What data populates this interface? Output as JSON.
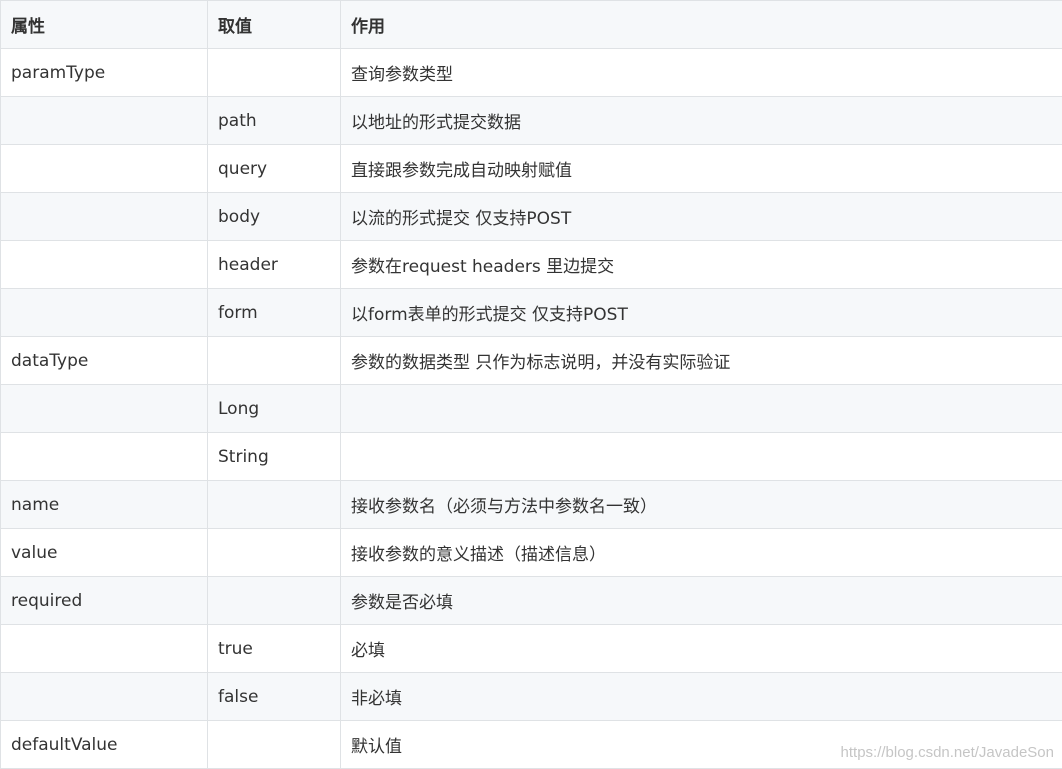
{
  "table": {
    "headers": [
      "属性",
      "取值",
      "作用"
    ],
    "rows": [
      [
        "paramType",
        "",
        "查询参数类型"
      ],
      [
        "",
        "path",
        "以地址的形式提交数据"
      ],
      [
        "",
        "query",
        "直接跟参数完成自动映射赋值"
      ],
      [
        "",
        "body",
        "以流的形式提交 仅支持POST"
      ],
      [
        "",
        "header",
        "参数在request headers 里边提交"
      ],
      [
        "",
        "form",
        "以form表单的形式提交 仅支持POST"
      ],
      [
        "dataType",
        "",
        "参数的数据类型 只作为标志说明，并没有实际验证"
      ],
      [
        "",
        "Long",
        ""
      ],
      [
        "",
        "String",
        ""
      ],
      [
        "name",
        "",
        "接收参数名（必须与方法中参数名一致）"
      ],
      [
        "value",
        "",
        "接收参数的意义描述（描述信息）"
      ],
      [
        "required",
        "",
        "参数是否必填"
      ],
      [
        "",
        "true",
        "必填"
      ],
      [
        "",
        "false",
        "非必填"
      ],
      [
        "defaultValue",
        "",
        "默认值"
      ]
    ]
  },
  "watermark": "https://blog.csdn.net/JavadeSon"
}
